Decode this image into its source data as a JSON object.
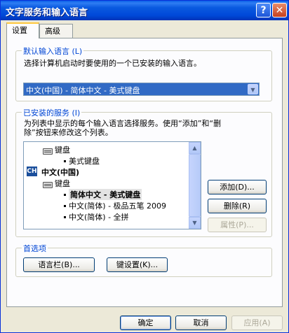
{
  "window": {
    "title": "文字服务和输入语言",
    "help_label": "?",
    "close_label": "✕"
  },
  "tabs": [
    {
      "label": "设置"
    },
    {
      "label": "高级"
    }
  ],
  "default_lang": {
    "legend": "默认输入语言 (L)",
    "description": "选择计算机启动时要使用的一个已安装的输入语言。",
    "selected": "中文(中国) - 简体中文 - 美式键盘"
  },
  "installed": {
    "legend": "已安装的服务 (I)",
    "description_line1": "为列表中显示的每个输入语言选择服务。使用“添加”和“删",
    "description_line2": "除”按钮来修改这个列表。",
    "tree": {
      "keyboard1": "键盘",
      "us_keyboard": "美式键盘",
      "lang_badge": "CH",
      "lang_name": "中文(中国)",
      "keyboard2": "键盘",
      "item1": "简体中文 - 美式键盘",
      "item2": "中文(简体) - 极品五笔 2009",
      "item3": "中文(简体) - 全拼"
    },
    "add_label": "添加(D)...",
    "remove_label": "删除(R)",
    "props_label": "属性(P)..."
  },
  "preferences": {
    "legend": "首选项",
    "langbar_label": "语言栏(B)...",
    "keysettings_label": "键设置(K)..."
  },
  "footer": {
    "ok_label": "确定",
    "cancel_label": "取消",
    "apply_label": "应用(A)"
  }
}
